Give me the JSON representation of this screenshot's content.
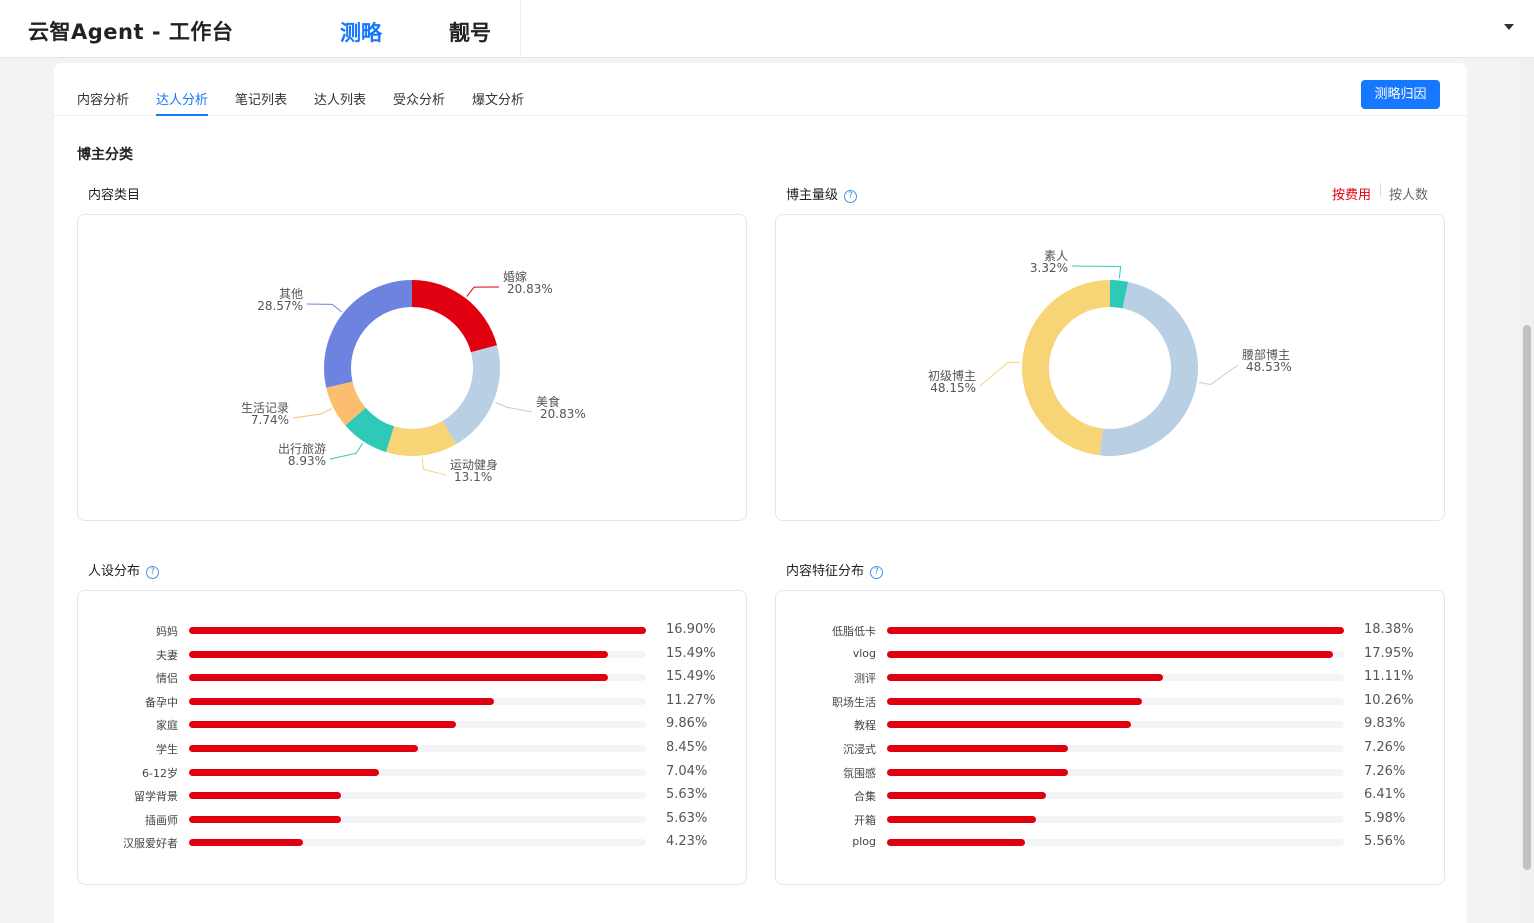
{
  "header": {
    "app_title": "云智Agent - 工作台",
    "tabs": [
      "测略",
      "靓号"
    ],
    "active_tab": 0
  },
  "subtabs": [
    "内容分析",
    "达人分析",
    "笔记列表",
    "达人列表",
    "受众分析",
    "爆文分析"
  ],
  "active_subtab": 1,
  "attribution_button": "测略归因",
  "section_title": "博主分类",
  "content_category": {
    "title": "内容类目",
    "chart_data": {
      "type": "pie",
      "donut": true,
      "slices": [
        {
          "label": "婚嫁",
          "value": 20.83,
          "text": "20.83%",
          "color": "#e0000f"
        },
        {
          "label": "美食",
          "value": 20.83,
          "text": "20.83%",
          "color": "#b9cfe3"
        },
        {
          "label": "运动健身",
          "value": 13.1,
          "text": "13.1%",
          "color": "#f7d576"
        },
        {
          "label": "出行旅游",
          "value": 8.93,
          "text": "8.93%",
          "color": "#2ec9b7"
        },
        {
          "label": "生活记录",
          "value": 7.74,
          "text": "7.74%",
          "color": "#fcbe6e"
        },
        {
          "label": "其他",
          "value": 28.57,
          "text": "28.57%",
          "color": "#6e83e0"
        }
      ]
    }
  },
  "blogger_level": {
    "title": "博主量级",
    "help": "?",
    "toggle_on": "按费用",
    "toggle_off": "按人数",
    "chart_data": {
      "type": "pie",
      "donut": true,
      "slices": [
        {
          "label": "素人",
          "value": 3.32,
          "text": "3.32%",
          "color": "#2ec9b7"
        },
        {
          "label": "腰部博主",
          "value": 48.53,
          "text": "48.53%",
          "color": "#b9cfe3"
        },
        {
          "label": "初级博主",
          "value": 48.15,
          "text": "48.15%",
          "color": "#f7d576"
        }
      ]
    }
  },
  "persona": {
    "title": "人设分布",
    "help": "?",
    "chart_data": {
      "type": "bar",
      "orientation": "horizontal",
      "color": "#e0000f",
      "max": 16.9,
      "categories": [
        "妈妈",
        "夫妻",
        "情侣",
        "备孕中",
        "家庭",
        "学生",
        "6-12岁",
        "留学背景",
        "插画师",
        "汉服爱好者"
      ],
      "values": [
        16.9,
        15.49,
        15.49,
        11.27,
        9.86,
        8.45,
        7.04,
        5.63,
        5.63,
        4.23
      ],
      "value_labels": [
        "16.90%",
        "15.49%",
        "15.49%",
        "11.27%",
        "9.86%",
        "8.45%",
        "7.04%",
        "5.63%",
        "5.63%",
        "4.23%"
      ]
    }
  },
  "content_feature": {
    "title": "内容特征分布",
    "help": "?",
    "chart_data": {
      "type": "bar",
      "orientation": "horizontal",
      "color": "#e0000f",
      "max": 18.38,
      "categories": [
        "低脂低卡",
        "vlog",
        "测评",
        "职场生活",
        "教程",
        "沉浸式",
        "氛围感",
        "合集",
        "开箱",
        "plog"
      ],
      "values": [
        18.38,
        17.95,
        11.11,
        10.26,
        9.83,
        7.26,
        7.26,
        6.41,
        5.98,
        5.56
      ],
      "value_labels": [
        "18.38%",
        "17.95%",
        "11.11%",
        "10.26%",
        "9.83%",
        "7.26%",
        "7.26%",
        "6.41%",
        "5.98%",
        "5.56%"
      ]
    }
  }
}
